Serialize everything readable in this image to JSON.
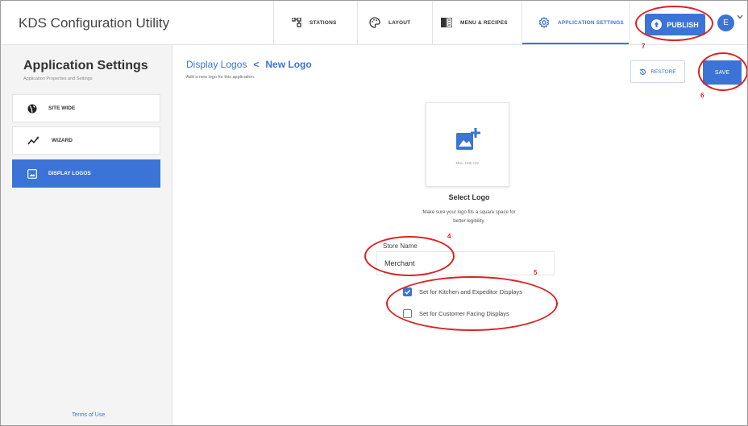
{
  "app": {
    "title": "KDS Configuration Utility"
  },
  "nav": {
    "tabs": [
      {
        "label": "STATIONS",
        "icon": "stations-icon"
      },
      {
        "label": "LAYOUT",
        "icon": "palette-icon"
      },
      {
        "label": "MENU & RECIPES",
        "icon": "book-icon"
      },
      {
        "label": "APPLICATION SETTINGS",
        "icon": "gear-icon",
        "active": true
      }
    ],
    "publish_label": "PUBLISH",
    "avatar_initial": "E"
  },
  "sidebar": {
    "title": "Application Settings",
    "subtitle": "Application Properties and Settings",
    "items": [
      {
        "label": "SITE WIDE",
        "icon": "globe-icon"
      },
      {
        "label": "WIZARD",
        "icon": "wizard-icon"
      },
      {
        "label": "DISPLAY LOGOS",
        "icon": "image-icon",
        "active": true
      }
    ],
    "terms": "Terms of Use"
  },
  "main": {
    "breadcrumb_parent": "Display Logos",
    "breadcrumb_sep": "<",
    "breadcrumb_current": "New Logo",
    "subtitle": "Add a new logo for this application.",
    "restore_label": "RESTORE",
    "save_label": "SAVE",
    "logo_hint": "Max. 1Mb size",
    "select_title": "Select Logo",
    "select_desc": "Make sure your logo fits a square space for better legibility.",
    "store_label": "Store Name",
    "store_value": "Merchant",
    "checkboxes": [
      {
        "label": "Set for Kitchen and Expeditor Displays",
        "checked": true
      },
      {
        "label": "Set for Customer Facing Displays",
        "checked": false
      }
    ]
  },
  "annotations": [
    "4",
    "5",
    "6",
    "7"
  ],
  "colors": {
    "accent": "#3b74d6",
    "annotation": "#d22222"
  }
}
